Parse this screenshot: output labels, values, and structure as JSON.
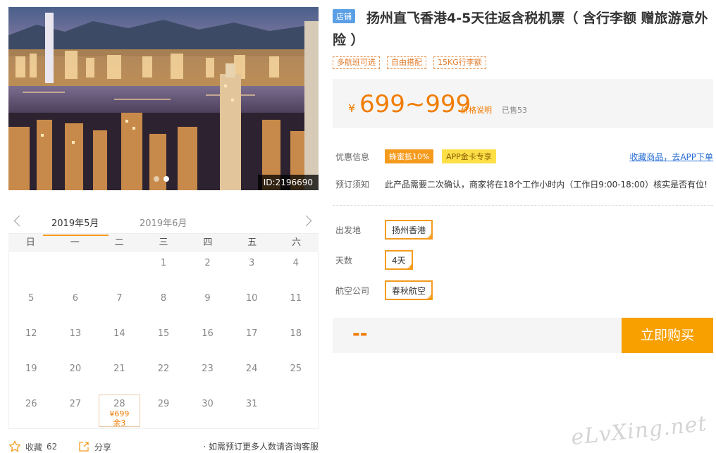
{
  "hero": {
    "image_id": "ID:2196690",
    "slide_count": 2,
    "active_slide": 2
  },
  "calendar": {
    "months": [
      "2019年5月",
      "2019年6月"
    ],
    "weekdays": [
      "日",
      "一",
      "二",
      "三",
      "四",
      "五",
      "六"
    ],
    "cells": [
      "",
      "",
      "",
      "1",
      "2",
      "3",
      "4",
      "5",
      "6",
      "7",
      "8",
      "9",
      "10",
      "11",
      "12",
      "13",
      "14",
      "15",
      "16",
      "17",
      "18",
      "19",
      "20",
      "21",
      "22",
      "23",
      "24",
      "25",
      "26",
      "27",
      "28",
      "29",
      "30",
      "31",
      ""
    ],
    "available": {
      "day": "28",
      "price": "¥699",
      "remain": "余3"
    }
  },
  "footer": {
    "fav_label": "收藏",
    "fav_count": "62",
    "share_label": "分享",
    "note": "· 如需预订更多人数请咨询客服"
  },
  "product": {
    "store_badge": "店铺",
    "title": "扬州直飞香港4-5天往返含税机票（ 含行李额 赠旅游意外险 ）",
    "tags": [
      "多航班可选",
      "自由搭配",
      "15KG行李额"
    ]
  },
  "price": {
    "currency": "¥",
    "range": "699~999",
    "explain_link": "价格说明",
    "sold": "已售53"
  },
  "promo": {
    "label": "优惠信息",
    "badge1": "蜂蜜抵10%",
    "badge2": "APP金卡专享",
    "app_link": "收藏商品，去APP下单"
  },
  "booking_notice": {
    "label": "预订须知",
    "text": "此产品需要二次确认，商家将在18个工作小时内（工作日9:00-18:00）核实是否有位!"
  },
  "options": {
    "departure": {
      "label": "出发地",
      "value": "扬州香港"
    },
    "days": {
      "label": "天数",
      "value": "4天"
    },
    "airline": {
      "label": "航空公司",
      "value": "春秋航空"
    }
  },
  "buy": {
    "total": "--",
    "button": "立即购买"
  },
  "watermark": "eLvXing.net",
  "colors": {
    "accent": "#f49b1d",
    "price": "#f07c00",
    "link": "#2a6fd4",
    "store": "#5b9fe6"
  }
}
